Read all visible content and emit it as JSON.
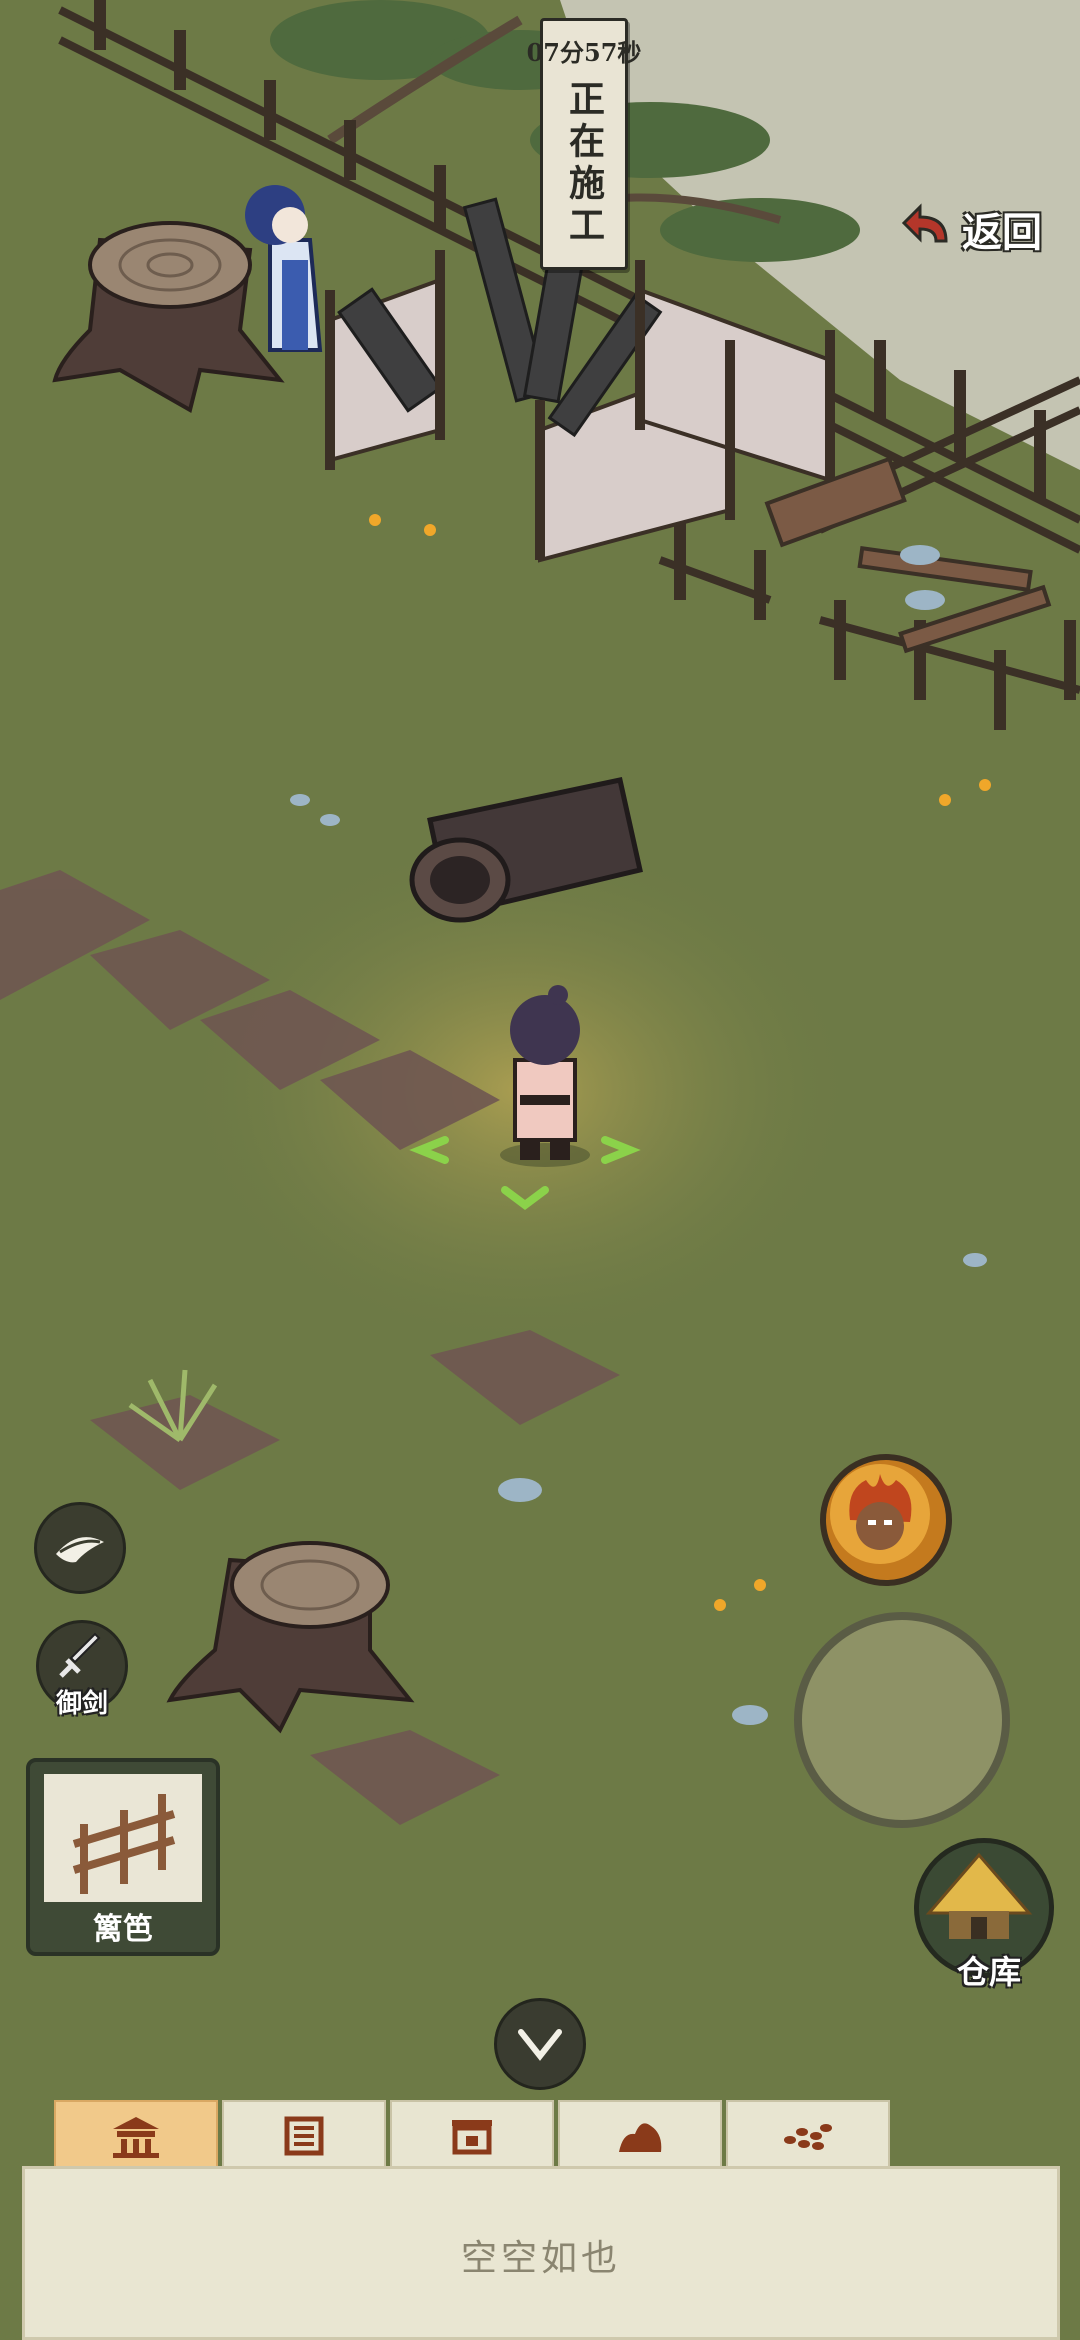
{
  "construction": {
    "timer": "07分57秒",
    "status": "正在施工"
  },
  "back_button": {
    "label": "返回",
    "icon": "back-arrow-icon"
  },
  "skills": {
    "vision": {
      "icon": "eye-icon"
    },
    "sword": {
      "label": "御剑",
      "icon": "sword-icon"
    }
  },
  "build_card": {
    "label": "篱笆",
    "icon": "fence-icon"
  },
  "avatar_button": {
    "icon": "flame-face-icon"
  },
  "joystick": {
    "icon": "joystick"
  },
  "warehouse_button": {
    "label": "仓库",
    "icon": "straw-hut-icon"
  },
  "collapse_button": {
    "icon": "chevron-down-icon"
  },
  "tabs": [
    {
      "icon": "building-icon",
      "active": true
    },
    {
      "icon": "field-icon",
      "active": false
    },
    {
      "icon": "furniture-icon",
      "active": false
    },
    {
      "icon": "rock-icon",
      "active": false
    },
    {
      "icon": "seed-icon",
      "active": false
    }
  ],
  "inventory_panel": {
    "empty_text": "空空如也"
  },
  "colors": {
    "grass": "#6d7a46",
    "paper": "#e9e6d2",
    "active_tab": "#f1c98a",
    "accent_red": "#b4362a"
  }
}
